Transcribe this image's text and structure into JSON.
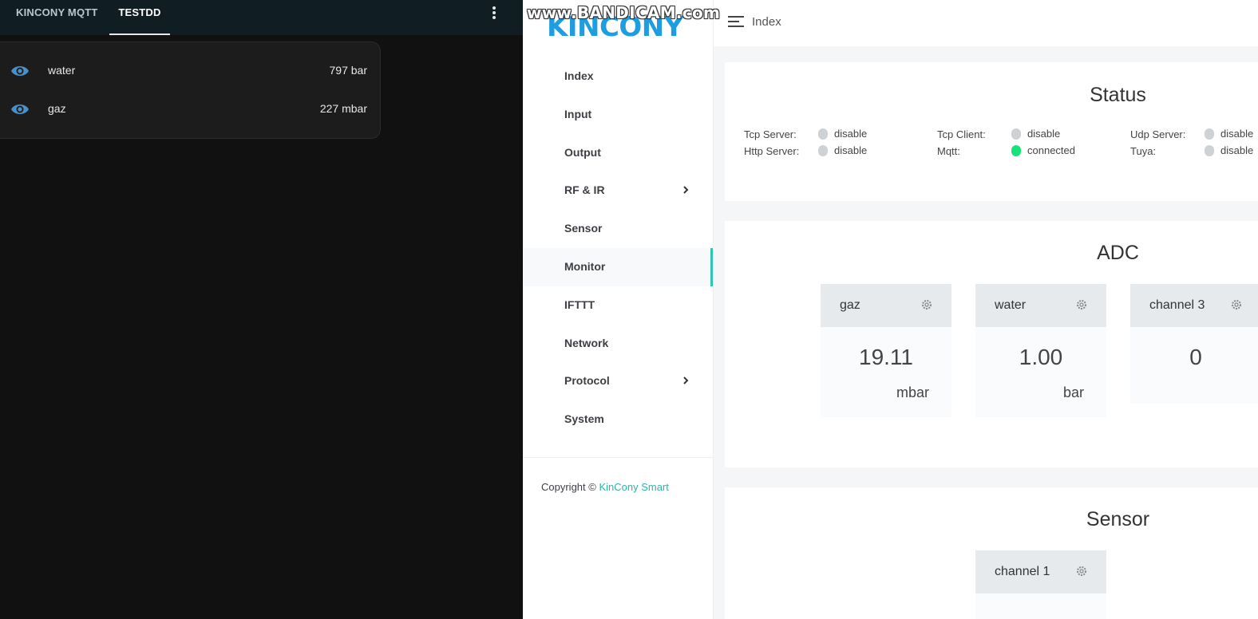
{
  "left_panel": {
    "tabs": [
      {
        "label": "KINCONY MQTT",
        "active": false
      },
      {
        "label": "TESTDD",
        "active": true
      }
    ],
    "entities": [
      {
        "name": "water",
        "value": "797 bar",
        "icon": "eye-icon"
      },
      {
        "name": "gaz",
        "value": "227 mbar",
        "icon": "eye-icon"
      }
    ]
  },
  "watermark": "www.BANDICAM.com",
  "web": {
    "logo": "KINCONY",
    "breadcrumb": "Index",
    "nav": [
      {
        "label": "Index",
        "has_submenu": false
      },
      {
        "label": "Input",
        "has_submenu": false
      },
      {
        "label": "Output",
        "has_submenu": false
      },
      {
        "label": "RF & IR",
        "has_submenu": true
      },
      {
        "label": "Sensor",
        "has_submenu": false
      },
      {
        "label": "Monitor",
        "has_submenu": false,
        "active": true
      },
      {
        "label": "IFTTT",
        "has_submenu": false
      },
      {
        "label": "Network",
        "has_submenu": false
      },
      {
        "label": "Protocol",
        "has_submenu": true
      },
      {
        "label": "System",
        "has_submenu": false
      }
    ],
    "copyright": {
      "prefix": "Copyright ©",
      "link": "KinCony Smart"
    },
    "status": {
      "title": "Status",
      "items": [
        {
          "label": "Tcp Server:",
          "value": "disable",
          "on": false
        },
        {
          "label": "Http Server:",
          "value": "disable",
          "on": false
        },
        {
          "label": "Tcp Client:",
          "value": "disable",
          "on": false
        },
        {
          "label": "Mqtt:",
          "value": "connected",
          "on": true
        },
        {
          "label": "Udp Server:",
          "value": "disable",
          "on": false
        },
        {
          "label": "Tuya:",
          "value": "disable",
          "on": false
        }
      ]
    },
    "adc": {
      "title": "ADC",
      "channels": [
        {
          "name": "gaz",
          "value": "19.11",
          "unit": "mbar"
        },
        {
          "name": "water",
          "value": "1.00",
          "unit": "bar"
        },
        {
          "name": "channel 3",
          "value": "0",
          "unit": ""
        }
      ]
    },
    "sensor": {
      "title": "Sensor",
      "channels": [
        {
          "name": "channel 1"
        }
      ]
    }
  },
  "colors": {
    "accent": "#2ec4b6",
    "logo": "#1e9ee0",
    "connected": "#19e27a",
    "disabled_dot": "#cfd2d5",
    "dark_bg": "#111111",
    "eye_icon": "#4a90c8"
  }
}
